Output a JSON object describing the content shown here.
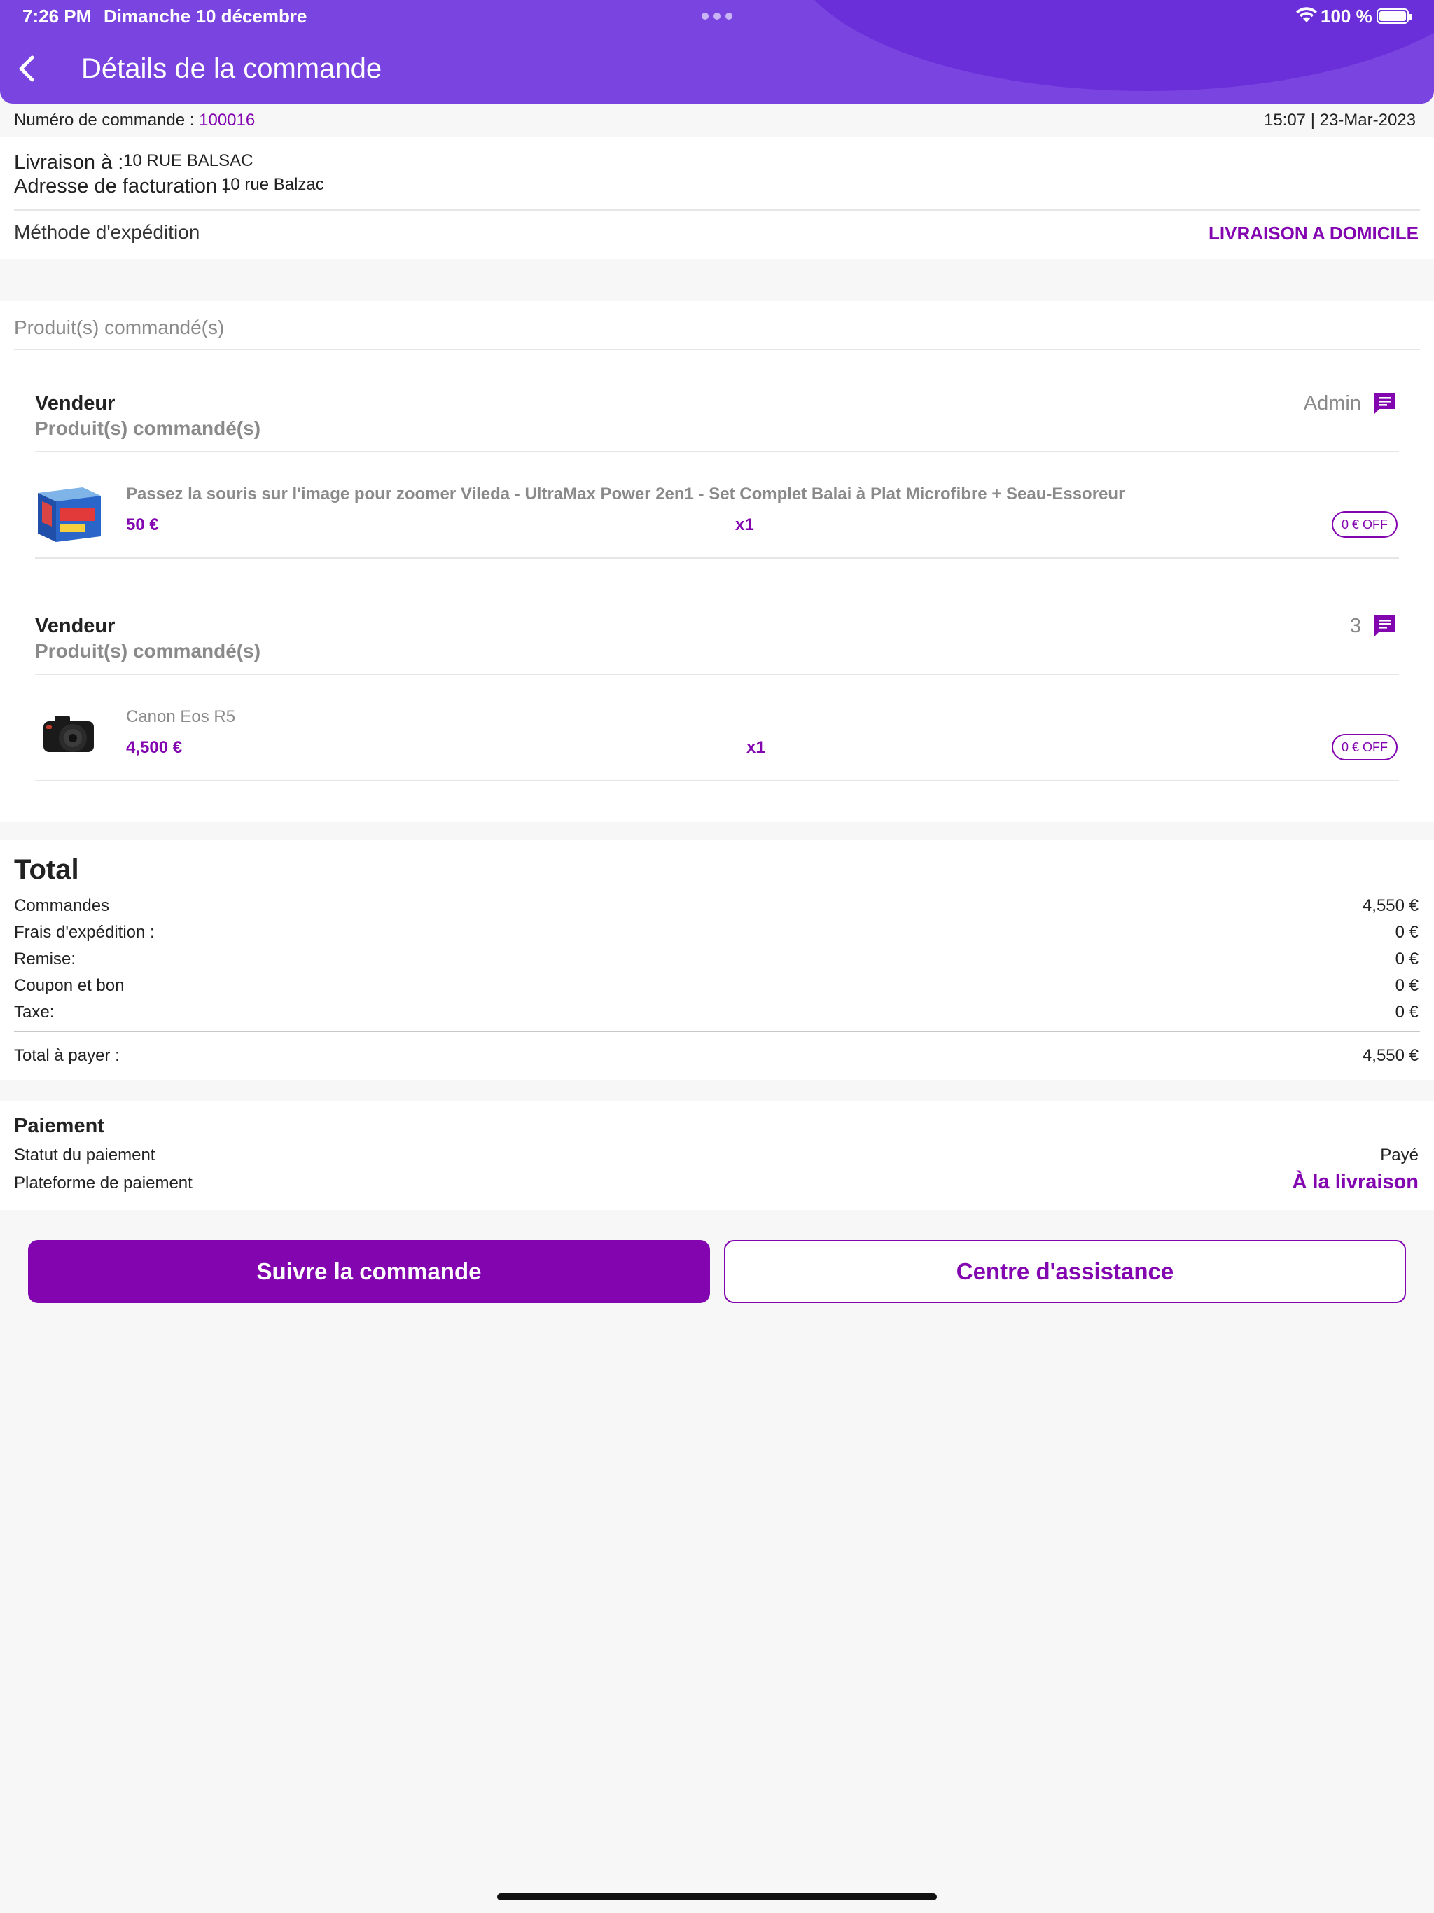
{
  "status_bar": {
    "time": "7:26 PM",
    "date": "Dimanche 10 décembre",
    "battery": "100 %"
  },
  "header": {
    "title": "Détails de la commande"
  },
  "order": {
    "number_label": "Numéro de commande :",
    "number": "100016",
    "datetime": "15:07 | 23-Mar-2023"
  },
  "address": {
    "delivery_label": "Livraison à :",
    "delivery_value": "10 RUE BALSAC",
    "billing_label": "Adresse de facturation :",
    "billing_value": "10 rue Balzac",
    "shipping_method_label": "Méthode d'expédition",
    "shipping_method_value": "LIVRAISON A DOMICILE"
  },
  "products_heading": "Produit(s) commandé(s)",
  "sellers": [
    {
      "vendor_label": "Vendeur",
      "vendor_name": "Admin",
      "subheading": "Produit(s) commandé(s)",
      "item": {
        "name": "Passez la souris sur l'image pour zoomer Vileda - UltraMax Power 2en1 - Set Complet Balai à Plat Microfibre + Seau-Essoreur",
        "price": "50 €",
        "qty": "x1",
        "discount": "0 € OFF"
      }
    },
    {
      "vendor_label": "Vendeur",
      "vendor_name": "3",
      "subheading": "Produit(s) commandé(s)",
      "item": {
        "name": "Canon Eos R5",
        "price": "4,500 €",
        "qty": "x1",
        "discount": "0 € OFF"
      }
    }
  ],
  "totals": {
    "heading": "Total",
    "rows": [
      {
        "label": "Commandes",
        "value": "4,550 €"
      },
      {
        "label": "Frais d'expédition :",
        "value": "0 €"
      },
      {
        "label": "Remise:",
        "value": "0 €"
      },
      {
        "label": "Coupon et bon",
        "value": "0 €"
      },
      {
        "label": "Taxe:",
        "value": "0 €"
      }
    ],
    "grand_label": "Total à payer :",
    "grand_value": "4,550 €"
  },
  "payment": {
    "heading": "Paiement",
    "status_label": "Statut du paiement",
    "status_value": "Payé",
    "platform_label": "Plateforme de paiement",
    "platform_value": "À la livraison"
  },
  "actions": {
    "track_label": "Suivre la commande",
    "support_label": "Centre d'assistance"
  },
  "icons": {
    "back": "chevron-left-icon",
    "chat": "chat-icon",
    "wifi": "wifi-icon",
    "battery": "battery-icon"
  },
  "colors": {
    "header": "#7a44e0",
    "accent": "#8205b0"
  }
}
